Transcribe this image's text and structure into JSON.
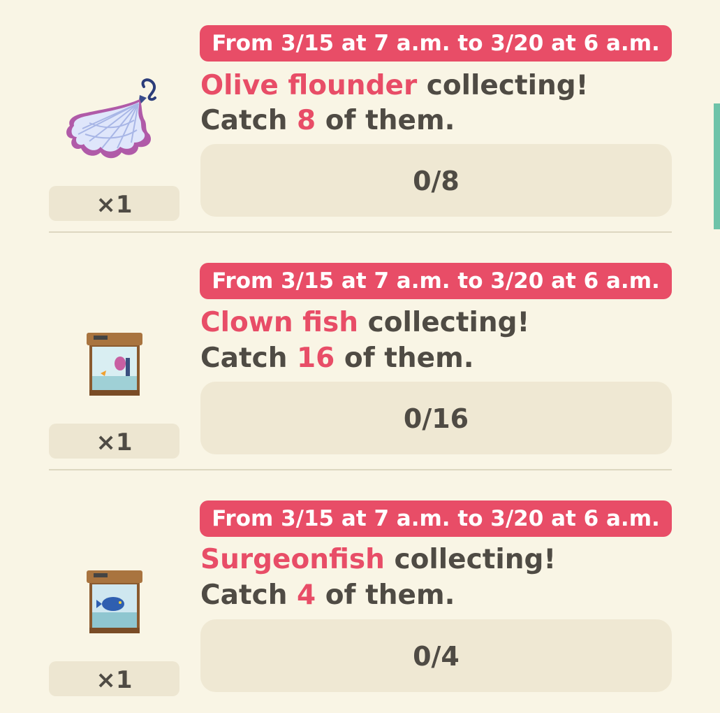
{
  "goals": [
    {
      "date": "From 3/15 at 7 a.m. to 3/20 at 6 a.m.",
      "fish": "Olive flounder",
      "collecting": " collecting!",
      "catch_prefix": "Catch ",
      "count": "8",
      "catch_suffix": " of them.",
      "progress": "0/8",
      "reward_icon": "net-icon",
      "reward_qty": "×1"
    },
    {
      "date": "From 3/15 at 7 a.m. to 3/20 at 6 a.m.",
      "fish": "Clown fish",
      "collecting": " collecting!",
      "catch_prefix": "Catch ",
      "count": "16",
      "catch_suffix": " of them.",
      "progress": "0/16",
      "reward_icon": "aquarium-icon",
      "reward_qty": "×1"
    },
    {
      "date": "From 3/15 at 7 a.m. to 3/20 at 6 a.m.",
      "fish": "Surgeonfish",
      "collecting": " collecting!",
      "catch_prefix": "Catch ",
      "count": "4",
      "catch_suffix": " of them.",
      "progress": "0/4",
      "reward_icon": "aquarium-icon",
      "reward_qty": "×1"
    }
  ],
  "colors": {
    "background": "#f9f5e5",
    "accent": "#e84d67",
    "text": "#4f4b44",
    "panel": "#efe8d3",
    "scrollbar": "#6fc3a9"
  }
}
